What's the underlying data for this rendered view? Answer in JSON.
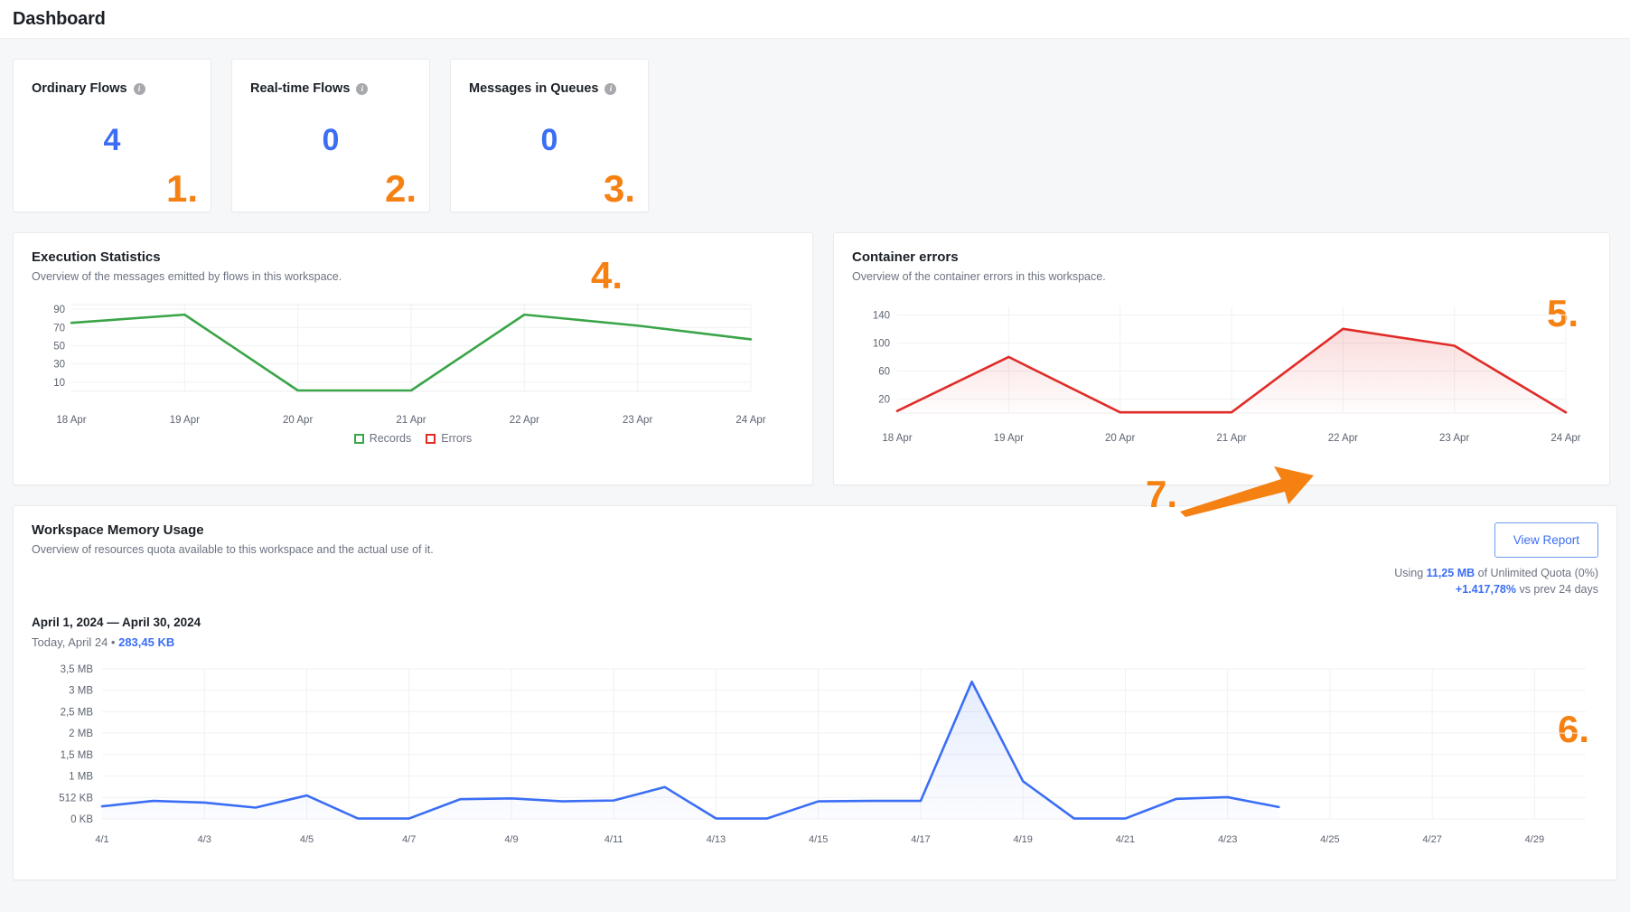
{
  "header": {
    "title": "Dashboard"
  },
  "colors": {
    "accent_blue": "#3b6ef5",
    "annotation_orange": "#f58113",
    "records_green": "#3aa548",
    "errors_red": "#e02b27",
    "page_bg": "#f6f7f9"
  },
  "stat_cards": [
    {
      "label": "Ordinary Flows",
      "value": "4",
      "info_icon": "info-icon",
      "annotation": "1."
    },
    {
      "label": "Real-time Flows",
      "value": "0",
      "info_icon": "info-icon",
      "annotation": "2."
    },
    {
      "label": "Messages in Queues",
      "value": "0",
      "info_icon": "info-icon",
      "annotation": "3."
    }
  ],
  "execution_panel": {
    "title": "Execution Statistics",
    "subtitle": "Overview of the messages emitted by flows in this workspace.",
    "annotation": "4.",
    "legend": [
      {
        "label": "Records",
        "color": "#3aa548"
      },
      {
        "label": "Errors",
        "color": "#e02b27"
      }
    ]
  },
  "container_panel": {
    "title": "Container errors",
    "subtitle": "Overview of the container errors in this workspace.",
    "annotation": "5."
  },
  "memory_panel": {
    "title": "Workspace Memory Usage",
    "subtitle": "Overview of resources quota available to this workspace and the actual use of it.",
    "date_range": "April 1, 2024 — April 30, 2024",
    "today_prefix": "Today, April 24 • ",
    "today_value": "283,45 KB",
    "view_report_label": "View Report",
    "quota_prefix": "Using ",
    "quota_value": "11,25 MB",
    "quota_suffix": " of Unlimited Quota (0%)",
    "delta_value": "+1.417,78%",
    "delta_suffix": " vs prev 24 days",
    "annotation_chart": "6.",
    "annotation_button": "7."
  },
  "chart_data": [
    {
      "id": "execution-statistics",
      "type": "line",
      "title": "Execution Statistics",
      "xlabel": "",
      "ylabel": "",
      "grid": true,
      "legend": [
        "Records",
        "Errors"
      ],
      "legend_position": "bottom-center",
      "categories": [
        "18 Apr",
        "19 Apr",
        "20 Apr",
        "21 Apr",
        "22 Apr",
        "23 Apr",
        "24 Apr"
      ],
      "ytick_labels": [
        "90",
        "70",
        "50",
        "30",
        "10"
      ],
      "ylim": [
        0,
        95
      ],
      "series": [
        {
          "name": "Records",
          "color": "#3aa548",
          "values": [
            75,
            84,
            1,
            1,
            84,
            72,
            57
          ]
        },
        {
          "name": "Errors",
          "color": "#e02b27",
          "values": [
            0,
            0,
            0,
            0,
            0,
            0,
            0
          ]
        }
      ]
    },
    {
      "id": "container-errors",
      "type": "area",
      "title": "Container errors",
      "xlabel": "",
      "ylabel": "",
      "grid": true,
      "categories": [
        "18 Apr",
        "19 Apr",
        "20 Apr",
        "21 Apr",
        "22 Apr",
        "23 Apr",
        "24 Apr"
      ],
      "ytick_labels": [
        "140",
        "100",
        "60",
        "20"
      ],
      "ylim": [
        0,
        150
      ],
      "series": [
        {
          "name": "Errors",
          "color": "#e02b27",
          "values": [
            3,
            80,
            1,
            1,
            120,
            96,
            1
          ]
        }
      ]
    },
    {
      "id": "workspace-memory-usage",
      "type": "area",
      "title": "Workspace Memory Usage",
      "xlabel": "",
      "ylabel": "",
      "grid": true,
      "unit": "bytes",
      "xtick_labels": [
        "4/1",
        "4/3",
        "4/5",
        "4/7",
        "4/9",
        "4/11",
        "4/13",
        "4/15",
        "4/17",
        "4/19",
        "4/21",
        "4/23",
        "4/25",
        "4/27",
        "4/29"
      ],
      "ytick_labels": [
        "3,5 MB",
        "3 MB",
        "2,5 MB",
        "2 MB",
        "1,5 MB",
        "1 MB",
        "512 KB",
        "0 KB"
      ],
      "ylim": [
        0,
        3670016
      ],
      "x": [
        "4/1",
        "4/2",
        "4/3",
        "4/4",
        "4/5",
        "4/6",
        "4/7",
        "4/8",
        "4/9",
        "4/10",
        "4/11",
        "4/12",
        "4/13",
        "4/14",
        "4/15",
        "4/16",
        "4/17",
        "4/18",
        "4/19",
        "4/20",
        "4/21",
        "4/22",
        "4/23",
        "4/24"
      ],
      "series": [
        {
          "name": "Memory",
          "color": "#3b6ef5",
          "values_label": [
            "300 KB",
            "430 KB",
            "390 KB",
            "270 KB",
            "560 KB",
            "10 KB",
            "10 KB",
            "470 KB",
            "490 KB",
            "420 KB",
            "440 KB",
            "760 KB",
            "10 KB",
            "10 KB",
            "420 KB",
            "430 KB",
            "430 KB",
            "3,2 MB",
            "900 KB",
            "10 KB",
            "10 KB",
            "480 KB",
            "520 KB",
            "283,45 KB"
          ],
          "values": [
            307200,
            440320,
            399360,
            276480,
            573440,
            10240,
            10240,
            481280,
            501760,
            430080,
            450560,
            778240,
            10240,
            10240,
            430080,
            440320,
            440320,
            3355443,
            921600,
            10240,
            10240,
            491520,
            532480,
            290253
          ]
        }
      ]
    }
  ]
}
